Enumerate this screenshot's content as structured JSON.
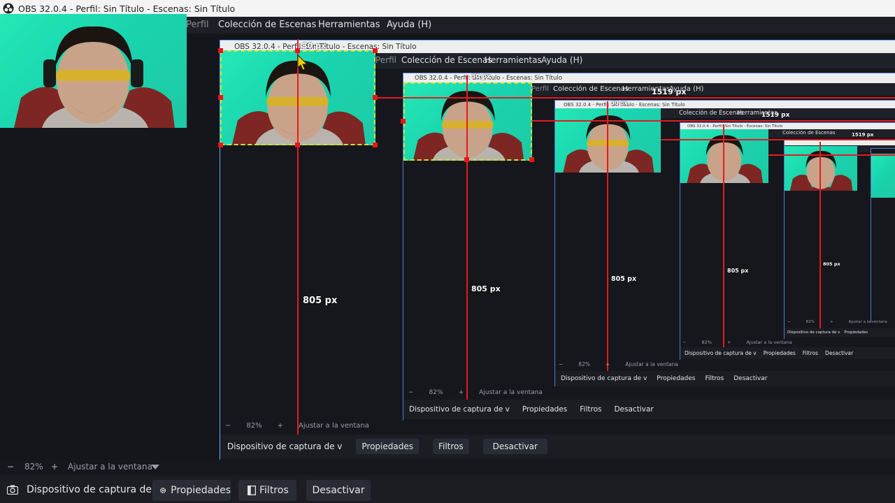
{
  "window": {
    "title": "OBS 32.0.4 - Perfil: Sin Título - Escenas: Sin Título",
    "nested_title": "OBS 32.0.4 - Perfil: Sin Título - Escenas: Sin Título"
  },
  "menu": {
    "perfil": "Perfil",
    "coleccion": "Colección de Escenas",
    "herramientas": "Herramientas",
    "ayuda": "Ayuda (H)"
  },
  "measurements": {
    "height_label": "805 px",
    "width_label": "1519 px",
    "offset_label": "30 px"
  },
  "zoom": {
    "minus": "−",
    "value": "82%",
    "plus": "+",
    "fit": "Ajustar a la ventana"
  },
  "source_toolbar": {
    "source_name": "Dispositivo de captura de v",
    "properties": "Propiedades",
    "filters": "Filtros",
    "deactivate": "Desactivar"
  },
  "icons": {
    "obs_logo": "obs-logo-icon",
    "camera": "camera-icon",
    "gear": "gear-icon",
    "filters": "filters-icon",
    "dropdown": "chevron-down-icon"
  },
  "colors": {
    "selection_border": "#69a6ff",
    "guide_red": "#e21b1f",
    "green_screen": "#22dcb0",
    "dashed_highlight": "#c6e63a"
  }
}
